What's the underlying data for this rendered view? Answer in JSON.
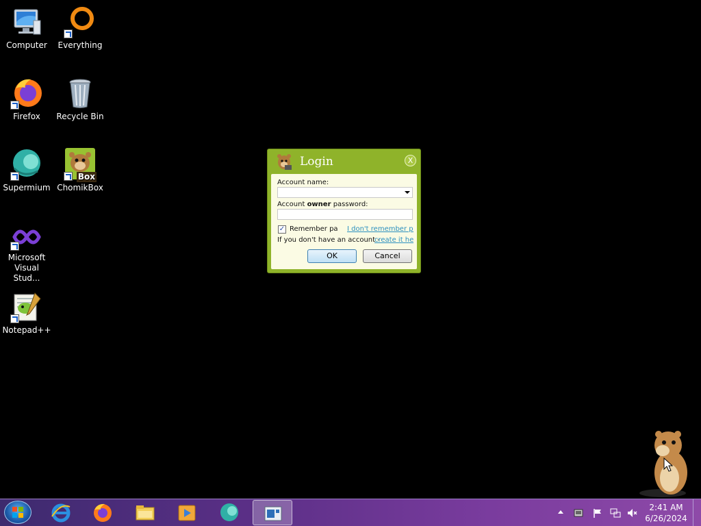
{
  "desktop": {
    "icons": [
      {
        "label": "Computer",
        "icon": "computer-icon"
      },
      {
        "label": "Everything",
        "icon": "everything-icon"
      },
      {
        "label": "Firefox",
        "icon": "firefox-icon"
      },
      {
        "label": "Recycle Bin",
        "icon": "recycle-bin-icon"
      },
      {
        "label": "Supermium",
        "icon": "supermium-icon"
      },
      {
        "label": "ChomikBox",
        "icon": "chomikbox-icon"
      },
      {
        "label": "Microsoft Visual Stud...",
        "icon": "visual-studio-icon"
      },
      {
        "label": "Notepad++",
        "icon": "notepad-plus-plus-icon"
      }
    ],
    "chomikbox_badge": "Box"
  },
  "login": {
    "title": "Login",
    "close_label": "X",
    "account_label": "Account name:",
    "account_value": "",
    "password_label_pre": "Account ",
    "password_label_bold": "owner",
    "password_label_post": " password:",
    "password_value": "",
    "remember_label": "Remember passw",
    "remember_checked": "✓",
    "forgot_link": "I don't remember pas",
    "no_account_text": "If you don't have an account -",
    "create_link": "create it here",
    "ok_label": "OK",
    "cancel_label": "Cancel"
  },
  "taskbar": {
    "pinned": [
      "internet-explorer-icon",
      "firefox-icon",
      "file-explorer-icon",
      "media-player-icon",
      "supermium-icon",
      "chomikbox-window-icon"
    ],
    "tray": [
      "show-hidden-icons-icon",
      "network-drive-icon",
      "action-center-flag-icon",
      "network-icon",
      "volume-muted-icon"
    ],
    "time": "2:41 AM",
    "date": "6/26/2024"
  }
}
